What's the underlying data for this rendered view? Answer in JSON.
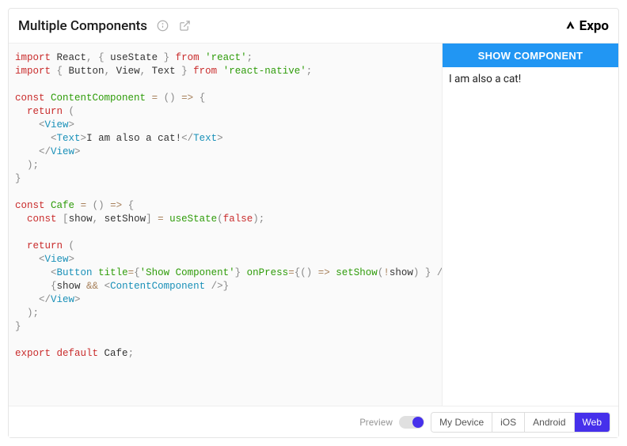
{
  "header": {
    "title": "Multiple Components",
    "brand": "Expo"
  },
  "code": {
    "lines": [
      [
        [
          "kw",
          "import"
        ],
        [
          "txt",
          " React"
        ],
        [
          "punc",
          ","
        ],
        [
          "txt",
          " "
        ],
        [
          "punc",
          "{"
        ],
        [
          "txt",
          " useState "
        ],
        [
          "punc",
          "}"
        ],
        [
          "txt",
          " "
        ],
        [
          "kw",
          "from"
        ],
        [
          "txt",
          " "
        ],
        [
          "str",
          "'react'"
        ],
        [
          "punc",
          ";"
        ]
      ],
      [
        [
          "kw",
          "import"
        ],
        [
          "txt",
          " "
        ],
        [
          "punc",
          "{"
        ],
        [
          "txt",
          " Button"
        ],
        [
          "punc",
          ","
        ],
        [
          "txt",
          " View"
        ],
        [
          "punc",
          ","
        ],
        [
          "txt",
          " Text "
        ],
        [
          "punc",
          "}"
        ],
        [
          "txt",
          " "
        ],
        [
          "kw",
          "from"
        ],
        [
          "txt",
          " "
        ],
        [
          "str",
          "'react-native'"
        ],
        [
          "punc",
          ";"
        ]
      ],
      [],
      [
        [
          "kw",
          "const"
        ],
        [
          "txt",
          " "
        ],
        [
          "fn",
          "ContentComponent"
        ],
        [
          "txt",
          " "
        ],
        [
          "op",
          "="
        ],
        [
          "txt",
          " "
        ],
        [
          "punc",
          "("
        ],
        [
          "punc",
          ")"
        ],
        [
          "txt",
          " "
        ],
        [
          "op",
          "=>"
        ],
        [
          "txt",
          " "
        ],
        [
          "punc",
          "{"
        ]
      ],
      [
        [
          "txt",
          "  "
        ],
        [
          "kw",
          "return"
        ],
        [
          "txt",
          " "
        ],
        [
          "punc",
          "("
        ]
      ],
      [
        [
          "txt",
          "    "
        ],
        [
          "punc",
          "<"
        ],
        [
          "tag",
          "View"
        ],
        [
          "punc",
          ">"
        ]
      ],
      [
        [
          "txt",
          "      "
        ],
        [
          "punc",
          "<"
        ],
        [
          "tag",
          "Text"
        ],
        [
          "punc",
          ">"
        ],
        [
          "txt",
          "I am also a cat!"
        ],
        [
          "punc",
          "</"
        ],
        [
          "tag",
          "Text"
        ],
        [
          "punc",
          ">"
        ]
      ],
      [
        [
          "txt",
          "    "
        ],
        [
          "punc",
          "</"
        ],
        [
          "tag",
          "View"
        ],
        [
          "punc",
          ">"
        ]
      ],
      [
        [
          "txt",
          "  "
        ],
        [
          "punc",
          ")"
        ],
        [
          "punc",
          ";"
        ]
      ],
      [
        [
          "punc",
          "}"
        ]
      ],
      [],
      [
        [
          "kw",
          "const"
        ],
        [
          "txt",
          " "
        ],
        [
          "fn",
          "Cafe"
        ],
        [
          "txt",
          " "
        ],
        [
          "op",
          "="
        ],
        [
          "txt",
          " "
        ],
        [
          "punc",
          "("
        ],
        [
          "punc",
          ")"
        ],
        [
          "txt",
          " "
        ],
        [
          "op",
          "=>"
        ],
        [
          "txt",
          " "
        ],
        [
          "punc",
          "{"
        ]
      ],
      [
        [
          "txt",
          "  "
        ],
        [
          "kw",
          "const"
        ],
        [
          "txt",
          " "
        ],
        [
          "punc",
          "["
        ],
        [
          "txt",
          "show"
        ],
        [
          "punc",
          ","
        ],
        [
          "txt",
          " setShow"
        ],
        [
          "punc",
          "]"
        ],
        [
          "txt",
          " "
        ],
        [
          "op",
          "="
        ],
        [
          "txt",
          " "
        ],
        [
          "fn",
          "useState"
        ],
        [
          "punc",
          "("
        ],
        [
          "lit",
          "false"
        ],
        [
          "punc",
          ")"
        ],
        [
          "punc",
          ";"
        ]
      ],
      [],
      [
        [
          "txt",
          "  "
        ],
        [
          "kw",
          "return"
        ],
        [
          "txt",
          " "
        ],
        [
          "punc",
          "("
        ]
      ],
      [
        [
          "txt",
          "    "
        ],
        [
          "punc",
          "<"
        ],
        [
          "tag",
          "View"
        ],
        [
          "punc",
          ">"
        ]
      ],
      [
        [
          "txt",
          "      "
        ],
        [
          "punc",
          "<"
        ],
        [
          "tag",
          "Button"
        ],
        [
          "txt",
          " "
        ],
        [
          "fn",
          "title"
        ],
        [
          "op",
          "="
        ],
        [
          "punc",
          "{"
        ],
        [
          "str",
          "'Show Component'"
        ],
        [
          "punc",
          "}"
        ],
        [
          "txt",
          " "
        ],
        [
          "fn",
          "onPress"
        ],
        [
          "op",
          "="
        ],
        [
          "punc",
          "{"
        ],
        [
          "punc",
          "("
        ],
        [
          "punc",
          ")"
        ],
        [
          "txt",
          " "
        ],
        [
          "op",
          "=>"
        ],
        [
          "txt",
          " "
        ],
        [
          "fn",
          "setShow"
        ],
        [
          "punc",
          "("
        ],
        [
          "op",
          "!"
        ],
        [
          "txt",
          "show"
        ],
        [
          "punc",
          ")"
        ],
        [
          "txt",
          " "
        ],
        [
          "punc",
          "}"
        ],
        [
          "txt",
          " "
        ],
        [
          "punc",
          "/>"
        ]
      ],
      [
        [
          "txt",
          "      "
        ],
        [
          "punc",
          "{"
        ],
        [
          "txt",
          "show "
        ],
        [
          "op",
          "&&"
        ],
        [
          "txt",
          " "
        ],
        [
          "punc",
          "<"
        ],
        [
          "tag",
          "ContentComponent"
        ],
        [
          "txt",
          " "
        ],
        [
          "punc",
          "/>"
        ],
        [
          "punc",
          "}"
        ]
      ],
      [
        [
          "txt",
          "    "
        ],
        [
          "punc",
          "</"
        ],
        [
          "tag",
          "View"
        ],
        [
          "punc",
          ">"
        ]
      ],
      [
        [
          "txt",
          "  "
        ],
        [
          "punc",
          ")"
        ],
        [
          "punc",
          ";"
        ]
      ],
      [
        [
          "punc",
          "}"
        ]
      ],
      [],
      [
        [
          "kw",
          "export"
        ],
        [
          "txt",
          " "
        ],
        [
          "kw",
          "default"
        ],
        [
          "txt",
          " Cafe"
        ],
        [
          "punc",
          ";"
        ]
      ]
    ]
  },
  "preview": {
    "button_label": "SHOW COMPONENT",
    "text": "I am also a cat!"
  },
  "footer": {
    "preview_label": "Preview",
    "tabs": [
      "My Device",
      "iOS",
      "Android",
      "Web"
    ],
    "active_tab": "Web"
  }
}
